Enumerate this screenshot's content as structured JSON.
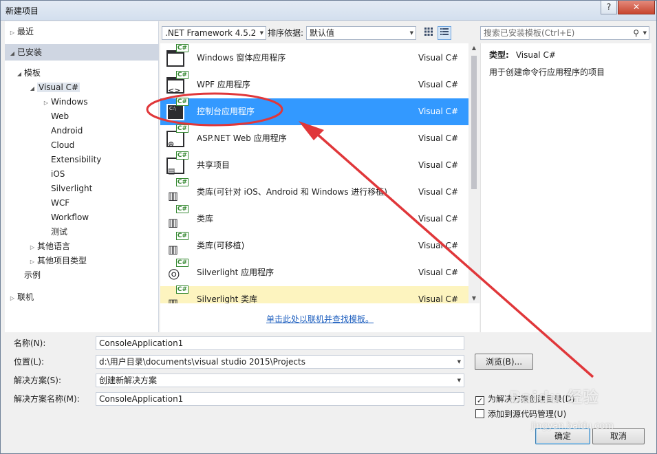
{
  "window": {
    "title": "新建项目",
    "help_label": "?",
    "close_label": "✕"
  },
  "tree": {
    "recent": "最近",
    "installed": "已安装",
    "templates": "模板",
    "visual_csharp": "Visual C#",
    "children": [
      "Windows",
      "Web",
      "Android",
      "Cloud",
      "Extensibility",
      "iOS",
      "Silverlight",
      "WCF",
      "Workflow",
      "测试"
    ],
    "other_languages": "其他语言",
    "other_project_types": "其他项目类型",
    "samples": "示例",
    "online": "联机"
  },
  "toolbar": {
    "framework": ".NET Framework 4.5.2",
    "sort_label": "排序依据:",
    "sort_value": "默认值",
    "grid_view_icon": "grid-view-icon",
    "list_view_icon": "list-view-icon"
  },
  "templates": [
    {
      "name": "Windows 窗体应用程序",
      "lang": "Visual C#",
      "icon": "winforms-icon"
    },
    {
      "name": "WPF 应用程序",
      "lang": "Visual C#",
      "icon": "wpf-icon"
    },
    {
      "name": "控制台应用程序",
      "lang": "Visual C#",
      "icon": "console-icon"
    },
    {
      "name": "ASP.NET Web 应用程序",
      "lang": "Visual C#",
      "icon": "web-icon"
    },
    {
      "name": "共享项目",
      "lang": "Visual C#",
      "icon": "shared-icon"
    },
    {
      "name": "类库(可针对 iOS、Android 和 Windows 进行移植)",
      "lang": "Visual C#",
      "icon": "library-icon"
    },
    {
      "name": "类库",
      "lang": "Visual C#",
      "icon": "library-icon"
    },
    {
      "name": "类库(可移植)",
      "lang": "Visual C#",
      "icon": "library-icon"
    },
    {
      "name": "Silverlight 应用程序",
      "lang": "Visual C#",
      "icon": "silverlight-icon"
    },
    {
      "name": "Silverlight 类库",
      "lang": "Visual C#",
      "icon": "library-icon"
    }
  ],
  "selected_template_index": 2,
  "online_link": "单击此处以联机并查找模板。",
  "search": {
    "placeholder": "搜索已安装模板(Ctrl+E)"
  },
  "details": {
    "type_label": "类型:",
    "type_value": "Visual C#",
    "description": "用于创建命令行应用程序的项目"
  },
  "form": {
    "name_label": "名称(N):",
    "name_value": "ConsoleApplication1",
    "location_label": "位置(L):",
    "location_value": "d:\\用户目录\\documents\\visual studio 2015\\Projects",
    "solution_label": "解决方案(S):",
    "solution_value": "创建新解决方案",
    "solution_name_label": "解决方案名称(M):",
    "solution_name_value": "ConsoleApplication1",
    "browse_label": "浏览(B)...",
    "create_dir_label": "为解决方案创建目录(D)",
    "create_dir_checked": true,
    "add_source_control_label": "添加到源代码管理(U)",
    "add_source_control_checked": false,
    "ok_label": "确定",
    "cancel_label": "取消"
  },
  "annotation": {
    "color": "#e0373a"
  },
  "watermark": {
    "brand": "Baidu 经验",
    "url": "jingyan.baidu.com"
  }
}
